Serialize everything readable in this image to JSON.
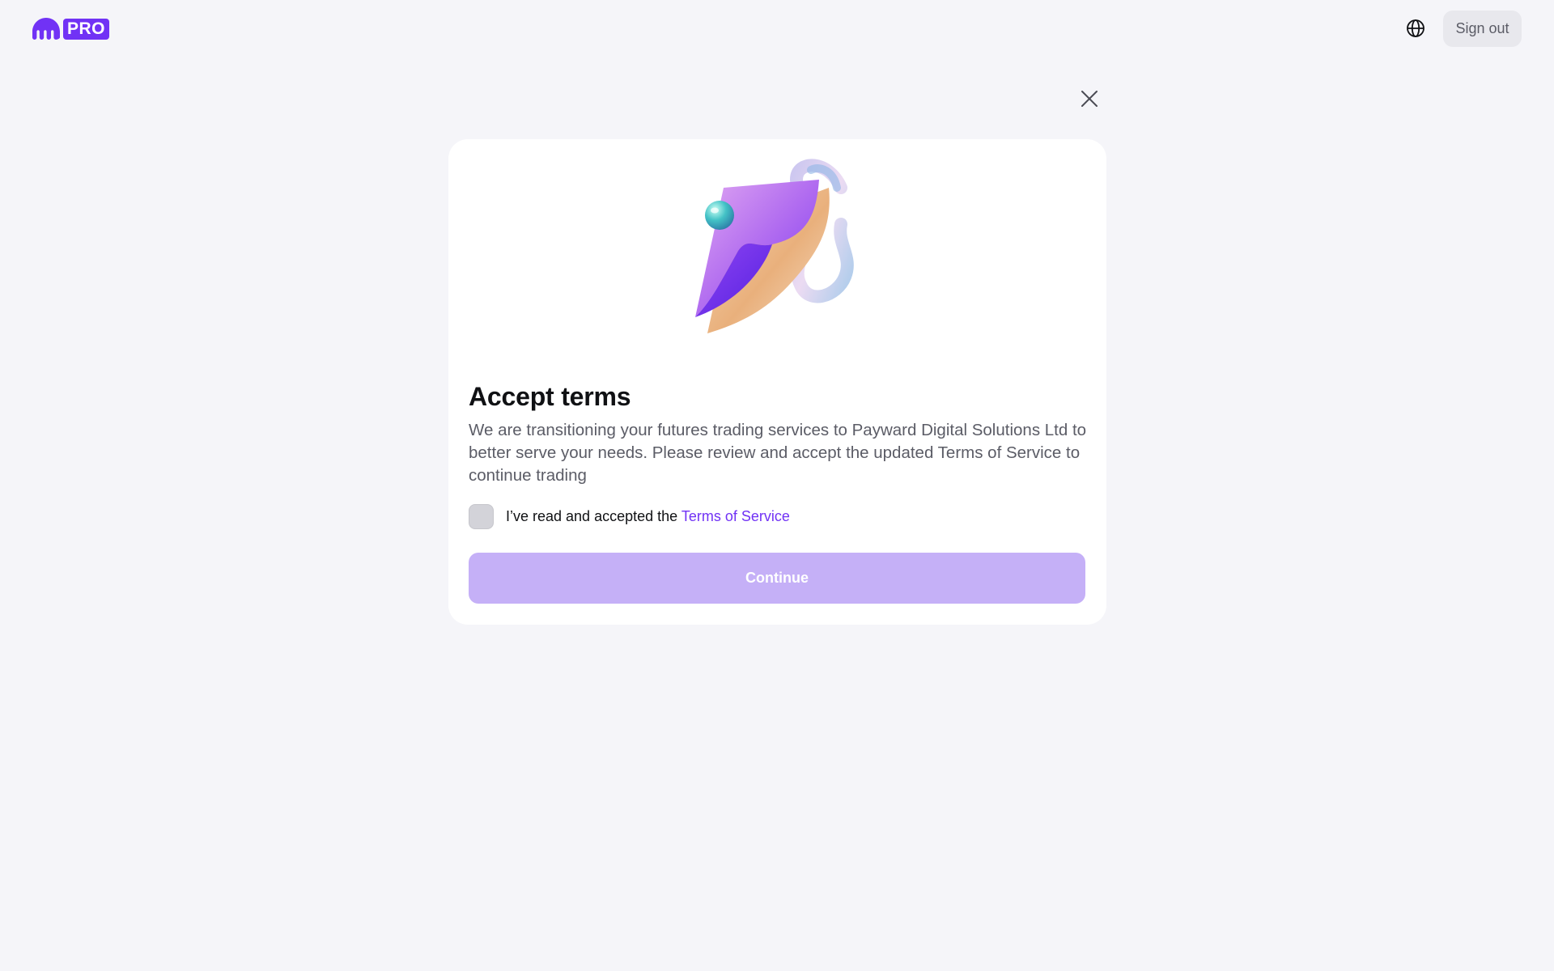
{
  "header": {
    "logo_badge": "PRO",
    "language_icon": "globe-icon",
    "sign_out_label": "Sign out"
  },
  "dialog": {
    "close_icon": "close-icon",
    "illustration": "document-swirl-illustration",
    "title": "Accept terms",
    "description": "We are transitioning your futures trading services to Payward Digital Solutions Ltd to better serve your needs. Please review and accept the updated Terms of Service to continue trading",
    "checkbox_checked": false,
    "accept_prefix": "I’ve read and accepted the ",
    "accept_link": "Terms of Service",
    "continue_label": "Continue",
    "continue_enabled": false
  },
  "colors": {
    "brand": "#7132f5",
    "background": "#f5f5f9",
    "card": "#ffffff",
    "button_disabled": "#c5b0f7",
    "secondary_button": "#e8e8ed",
    "muted_text": "#5b5c66"
  }
}
